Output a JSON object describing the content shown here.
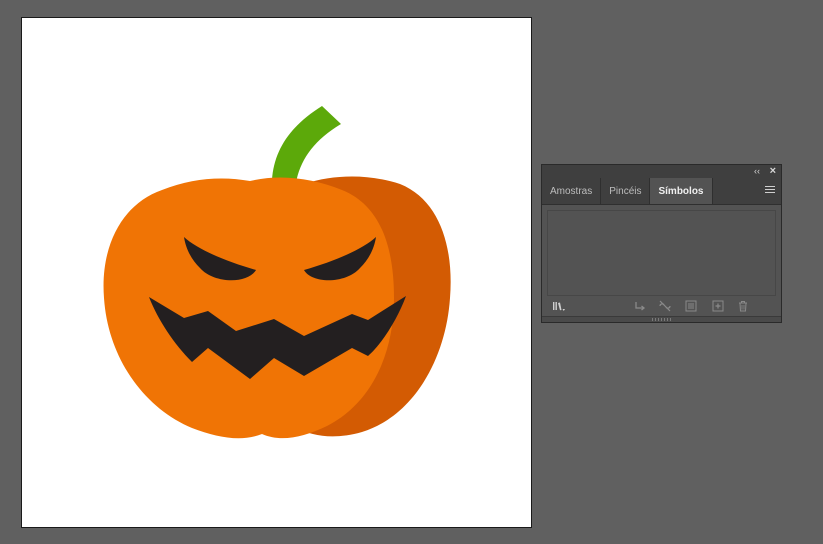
{
  "panel": {
    "collapse_glyph": "‹‹",
    "close_glyph": "×",
    "tabs": [
      {
        "label": "Amostras",
        "active": false
      },
      {
        "label": "Pincéis",
        "active": false
      },
      {
        "label": "Símbolos",
        "active": true
      }
    ],
    "toolbar_icons": [
      "symbol-libraries-icon",
      "place-symbol-icon",
      "break-link-icon",
      "symbol-options-icon",
      "new-symbol-icon",
      "delete-icon"
    ]
  },
  "artwork": {
    "colors": {
      "pumpkin_main": "#f07405",
      "pumpkin_shadow": "#d35b03",
      "stem": "#5ca90a",
      "face": "#231f20"
    }
  }
}
